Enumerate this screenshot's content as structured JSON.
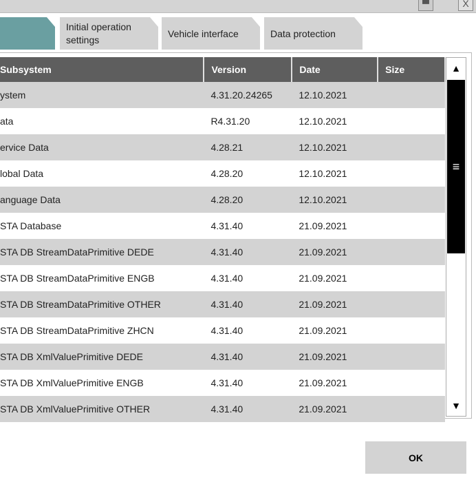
{
  "window": {
    "print_icon": "printer-icon",
    "close_label": "X"
  },
  "tabs": [
    {
      "label": ""
    },
    {
      "label": "Initial operation settings"
    },
    {
      "label": "Vehicle interface"
    },
    {
      "label": "Data protection"
    }
  ],
  "table": {
    "headers": [
      "Subsystem",
      "Version",
      "Date",
      "Size"
    ],
    "rows": [
      [
        "ystem",
        "4.31.20.24265",
        "12.10.2021",
        ""
      ],
      [
        "ata",
        "R4.31.20",
        "12.10.2021",
        ""
      ],
      [
        "ervice Data",
        "4.28.21",
        "12.10.2021",
        ""
      ],
      [
        "lobal Data",
        "4.28.20",
        "12.10.2021",
        ""
      ],
      [
        "anguage Data",
        "4.28.20",
        "12.10.2021",
        ""
      ],
      [
        "STA Database",
        "4.31.40",
        "21.09.2021",
        ""
      ],
      [
        "STA DB StreamDataPrimitive DEDE",
        "4.31.40",
        "21.09.2021",
        ""
      ],
      [
        "STA DB StreamDataPrimitive ENGB",
        "4.31.40",
        "21.09.2021",
        ""
      ],
      [
        "STA DB StreamDataPrimitive OTHER",
        "4.31.40",
        "21.09.2021",
        ""
      ],
      [
        "STA DB StreamDataPrimitive ZHCN",
        "4.31.40",
        "21.09.2021",
        ""
      ],
      [
        "STA DB XmlValuePrimitive DEDE",
        "4.31.40",
        "21.09.2021",
        ""
      ],
      [
        "STA DB XmlValuePrimitive ENGB",
        "4.31.40",
        "21.09.2021",
        ""
      ],
      [
        "STA DB XmlValuePrimitive OTHER",
        "4.31.40",
        "21.09.2021",
        ""
      ]
    ]
  },
  "scrollbar": {
    "up": "▲",
    "down": "▼",
    "grip": "≡"
  },
  "ok_label": "OK"
}
